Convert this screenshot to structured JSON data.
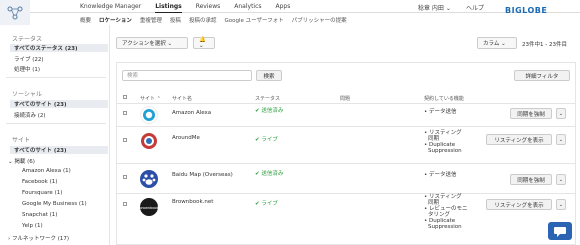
{
  "header": {
    "nav": [
      "Knowledge Manager",
      "Listings",
      "Reviews",
      "Analytics",
      "Apps"
    ],
    "active_nav": "Listings",
    "user": "稔章 内田 ⌄",
    "help": "ヘルプ",
    "brand": "BIGLOBE"
  },
  "subnav": {
    "items": [
      "概要",
      "ロケーション",
      "重複管理",
      "投稿",
      "投稿の承認",
      "Google ユーザーフォト",
      "パブリッシャーの提案"
    ],
    "active": "ロケーション"
  },
  "sidebar": {
    "status_heading": "ステータス",
    "status_items": [
      {
        "label": "すべてのステータス",
        "count": "(23)"
      },
      {
        "label": "ライブ",
        "count": "(22)"
      },
      {
        "label": "処理中",
        "count": "(1)"
      }
    ],
    "sources_heading": "ソーシャル",
    "sources_items": [
      {
        "label": "すべてのサイト",
        "count": "(23)"
      },
      {
        "label": "接続済み",
        "count": "(2)"
      }
    ],
    "sites_heading": "サイト",
    "sites_all": {
      "label": "すべてのサイト",
      "count": "(23)"
    },
    "sites_group": {
      "label": "掲載",
      "count": "(6)"
    },
    "sites_list": [
      {
        "label": "Amazon Alexa",
        "count": "(1)"
      },
      {
        "label": "Facebook",
        "count": "(1)"
      },
      {
        "label": "Foursquare",
        "count": "(1)"
      },
      {
        "label": "Google My Business",
        "count": "(1)"
      },
      {
        "label": "Snapchat",
        "count": "(1)"
      },
      {
        "label": "Yelp",
        "count": "(1)"
      }
    ],
    "network": {
      "label": "フルネットワーク",
      "count": "(17)"
    }
  },
  "toolbar": {
    "action_select": "アクションを選択 ⌄",
    "bell": "🔔 ⌄",
    "columns": "カラム ⌄",
    "range": "23件中1 - 23件目"
  },
  "search": {
    "placeholder": "検索",
    "button": "検索"
  },
  "detail_filter": "詳細フィルタ",
  "table": {
    "headers": [
      "サイト",
      "サイト名",
      "ステータス",
      "問題",
      "契約している機能"
    ],
    "rows": [
      {
        "name": "Amazon Alexa",
        "status": "✔ 送信済み",
        "features": [
          "• データ送信"
        ],
        "action": "同期を強制"
      },
      {
        "name": "AroundMe",
        "status": "✔ ライブ",
        "features": [
          "• リスティング",
          "同期",
          "• Duplicate",
          "Suppression"
        ],
        "action": "リスティングを表示"
      },
      {
        "name": "Baidu Map (Overseas)",
        "status": "✔ 送信済み",
        "features": [
          "• データ送信"
        ],
        "action": "同期を強制"
      },
      {
        "name": "Brownbook.net",
        "status": "✔ ライブ",
        "features": [
          "• リスティング",
          "同期",
          "• レビューのモニ",
          "タリング",
          "• Duplicate",
          "Suppression"
        ],
        "action": "リスティングを表示"
      }
    ]
  },
  "colors": {
    "accent": "#1b6ab3",
    "live": "#2e9d3f"
  }
}
